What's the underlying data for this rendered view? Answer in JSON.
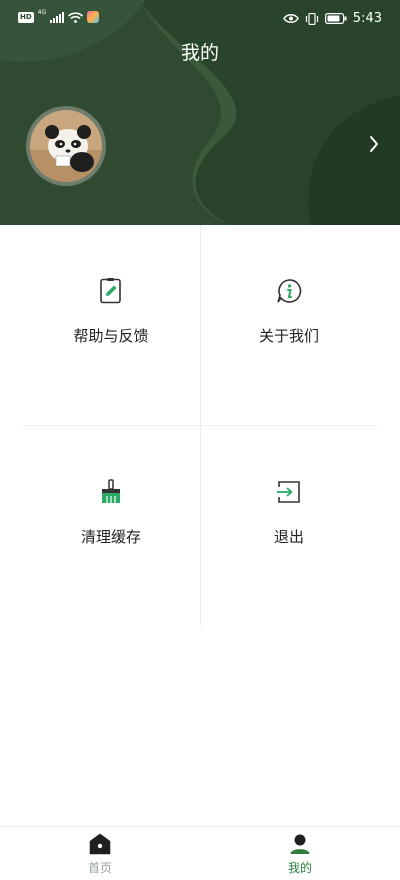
{
  "status_bar": {
    "network_badge": "HD",
    "sim_label": "4G",
    "time": "5:43"
  },
  "header": {
    "title": "我的"
  },
  "menu": [
    {
      "label": "帮助与反馈",
      "icon": "edit-note-icon"
    },
    {
      "label": "关于我们",
      "icon": "info-bubble-icon"
    },
    {
      "label": "清理缓存",
      "icon": "broom-icon"
    },
    {
      "label": "退出",
      "icon": "logout-icon"
    }
  ],
  "bottom_nav": {
    "items": [
      {
        "label": "首页",
        "icon": "home-icon",
        "active": false
      },
      {
        "label": "我的",
        "icon": "user-icon",
        "active": true
      }
    ]
  },
  "colors": {
    "header_bg": "#2f4a30",
    "header_shape_light": "#3b5a3c",
    "header_shape_dark": "#264126",
    "accent_green": "#2e7d3a",
    "icon_green": "#2aa866",
    "nav_inactive": "#9aa3a0",
    "text": "#222222"
  }
}
